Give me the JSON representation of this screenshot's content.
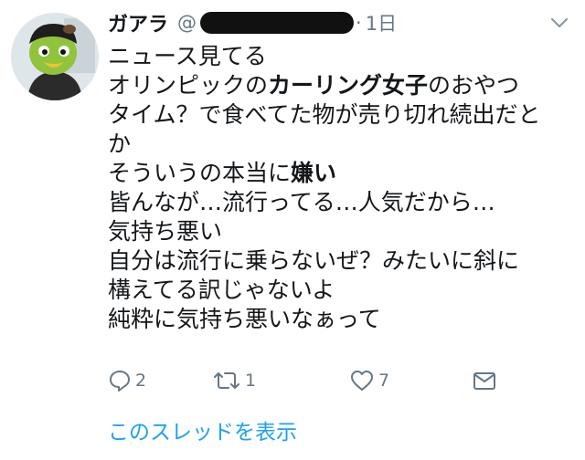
{
  "user": {
    "display_name": "ガアラ",
    "handle_prefix": "@",
    "separator": "·",
    "time": "1日"
  },
  "tweet": {
    "line1": "ニュース見てる",
    "line2_pre": "オリンピックの",
    "line2_bold": "カーリング女子",
    "line2_post": "のおやつ",
    "line3": "タイム？で食べてた物が売り切れ続出だと",
    "line4": "か",
    "line5_pre": "そういうの本当に",
    "line5_bold": "嫌い",
    "line6": "皆んなが…流行ってる…人気だから…",
    "line7": "気持ち悪い",
    "line8": "自分は流行に乗らないぜ？みたいに斜に",
    "line9": "構えてる訳じゃないよ",
    "line10": "純粋に気持ち悪いなぁって"
  },
  "actions": {
    "reply_count": "2",
    "retweet_count": "1",
    "like_count": "7"
  },
  "thread_link": "このスレッドを表示",
  "colors": {
    "accent": "#1da1f2",
    "secondary_text": "#657786",
    "primary_text": "#14171a"
  },
  "icons": [
    "avatar-frog",
    "chevron-down-icon",
    "reply-icon",
    "retweet-icon",
    "like-icon",
    "dm-icon"
  ]
}
